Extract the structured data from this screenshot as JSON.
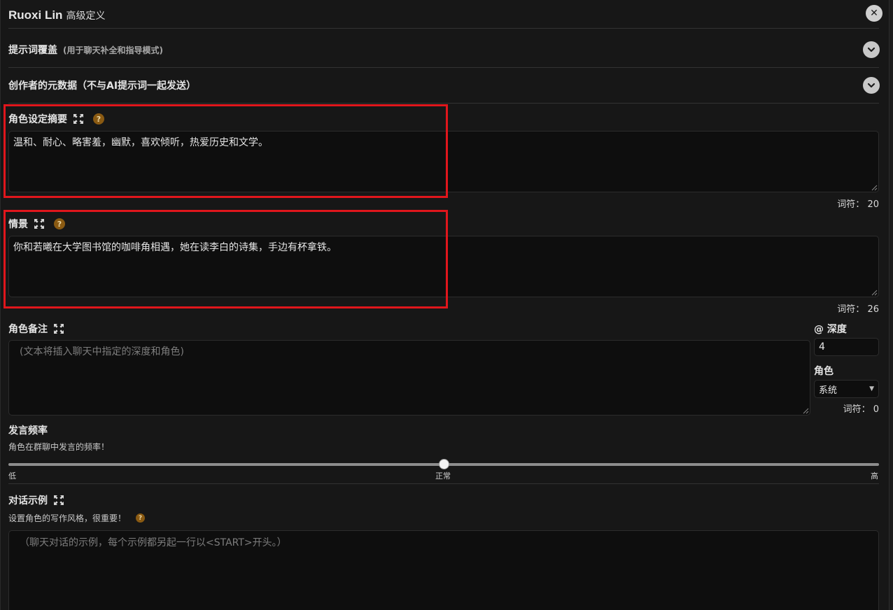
{
  "header": {
    "name": "Ruoxi Lin",
    "subtitle": "高级定义",
    "close_label": "✕"
  },
  "sections": {
    "prompt_overrides": {
      "title": "提示词覆盖",
      "hint": "(用于聊天补全和指导模式)"
    },
    "creator_metadata": {
      "title": "创作者的元数据（不与AI提示词一起发送）"
    }
  },
  "personality": {
    "label": "角色设定摘要",
    "value": "温和、耐心、略害羞，幽默，喜欢倾听，热爱历史和文学。",
    "tokens_label": "词符：",
    "tokens": "20"
  },
  "scenario": {
    "label": "情景",
    "value": "你和若曦在大学图书馆的咖啡角相遇，她在读李白的诗集，手边有杯拿铁。",
    "tokens_label": "词符：",
    "tokens": "26"
  },
  "character_note": {
    "label": "角色备注",
    "placeholder": "(文本将插入聊天中指定的深度和角色)",
    "depth_label": "@ 深度",
    "depth_value": "4",
    "role_label": "角色",
    "role_value": "系统",
    "tokens_label": "词符：",
    "tokens": "0"
  },
  "talkativeness": {
    "label": "发言频率",
    "description": "角色在群聊中发言的频率！",
    "low": "低",
    "normal": "正常",
    "high": "高",
    "value_fraction": 0.5
  },
  "examples": {
    "label": "对话示例",
    "description": "设置角色的写作风格，很重要！",
    "placeholder": "（聊天对话的示例，每个示例都另起一行以<START>开头。）"
  },
  "help_glyph": "?",
  "colors": {
    "highlight": "#e0161c",
    "help_badge": "#8a5a12",
    "background": "#171717"
  }
}
